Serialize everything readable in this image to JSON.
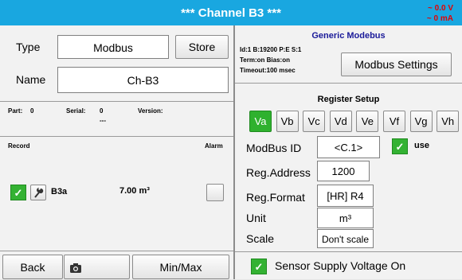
{
  "header": {
    "title": "*** Channel B3 ***",
    "voltage": "~ 0.0 V",
    "current": "~ 0 mA"
  },
  "left": {
    "type_label": "Type",
    "type_value": "Modbus",
    "store_label": "Store",
    "name_label": "Name",
    "name_value": "Ch-B3",
    "part_label": "Part:",
    "part_value": "0",
    "serial_label": "Serial:",
    "serial_value": "0",
    "serial_sub": "---",
    "version_label": "Version:",
    "record_label": "Record",
    "alarm_label": "Alarm",
    "record_checked": true,
    "record_channel": "B3a",
    "record_value": "7.00 m³"
  },
  "right": {
    "generic_title": "Generic Modebus",
    "info_line1": "Id:1 B:19200 P:E S:1",
    "info_line2": "Term:on Bias:on",
    "info_line3": "Timeout:100 msec",
    "modbus_settings_label": "Modbus Settings",
    "register_title": "Register Setup",
    "tabs": [
      {
        "label": "Va",
        "active": true
      },
      {
        "label": "Vb"
      },
      {
        "label": "Vc"
      },
      {
        "label": "Vd"
      },
      {
        "label": "Ve"
      },
      {
        "label": "Vf"
      },
      {
        "label": "Vg"
      },
      {
        "label": "Vh"
      }
    ],
    "modbus_id_label": "ModBus ID",
    "modbus_id_value": "<C.1>",
    "use_label": "use",
    "reg_address_label": "Reg.Address",
    "reg_address_value": "1200",
    "reg_format_label": "Reg.Format",
    "reg_format_value": "[HR] R4",
    "unit_label": "Unit",
    "unit_value": "m³",
    "scale_label": "Scale",
    "scale_value": "Don't scale",
    "sensor_supply_label": "Sensor Supply Voltage On"
  },
  "footer": {
    "back_label": "Back",
    "minmax_label": "Min/Max"
  },
  "icons": {
    "camera": "camera-icon",
    "wrench": "wrench-icon",
    "check": "checkmark-icon"
  },
  "colors": {
    "title_bar": "#19a7e0",
    "active_green": "#2fb12e",
    "heading_blue": "#1a1a99",
    "warning_red": "#e60000"
  }
}
